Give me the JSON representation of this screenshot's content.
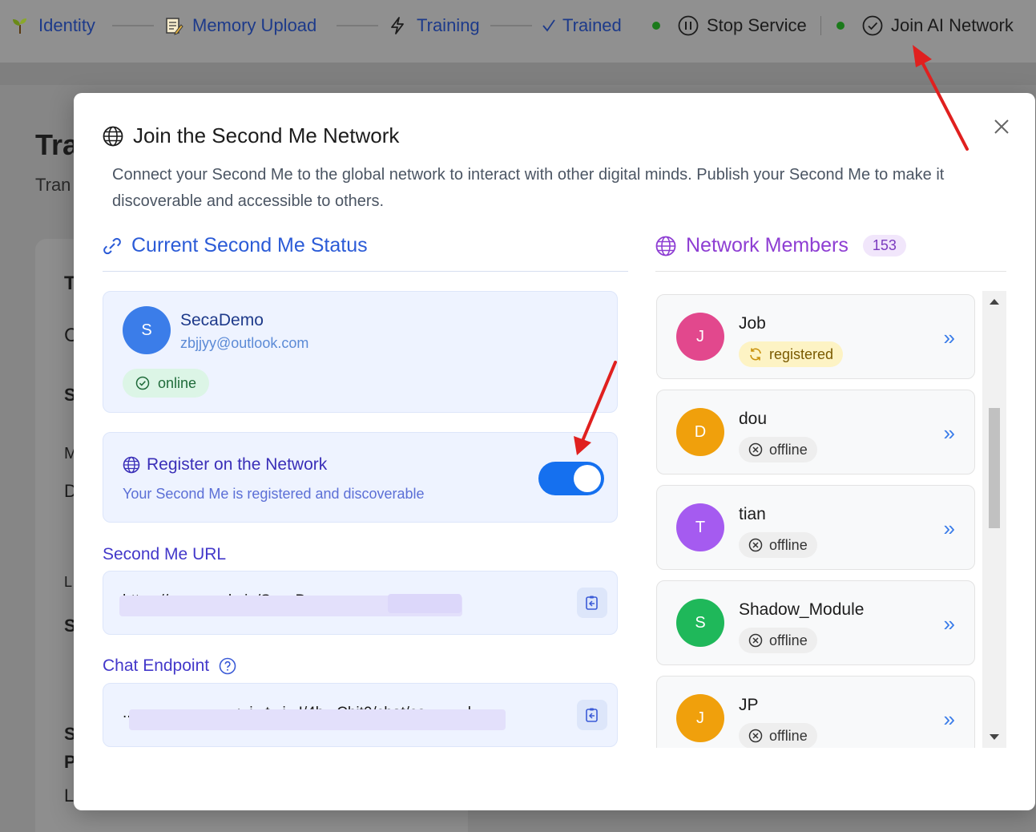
{
  "topnav": {
    "steps": [
      {
        "label": "Identity",
        "icon": "sprout-icon"
      },
      {
        "label": "Memory Upload",
        "icon": "document-edit-icon"
      },
      {
        "label": "Training",
        "icon": "lightning-icon"
      },
      {
        "label": "Trained",
        "icon": "check-icon"
      }
    ],
    "stop_service_label": "Stop Service",
    "join_network_label": "Join AI Network",
    "status_color": "#1b7a1b"
  },
  "background": {
    "title_fragment": "Tra",
    "subtitle_fragment": "Tran",
    "fragments": [
      "T",
      "C",
      "S",
      "M",
      "D",
      "L",
      "S",
      "S",
      "P",
      "L"
    ]
  },
  "modal": {
    "title": "Join the Second Me Network",
    "description": "Connect your Second Me to the global network to interact with other digital minds. Publish your Second Me to make it discoverable and accessible to others.",
    "status_section_title": "Current Second Me Status",
    "profile": {
      "initial": "S",
      "name": "SecaDemo",
      "email": "zbjjyy@outlook.com",
      "status": "online"
    },
    "register": {
      "title": "Register on the Network",
      "subtitle": "Your Second Me is registered and discoverable",
      "enabled": true
    },
    "url_label": "Second Me URL",
    "url_value": "https://...........oda.io/SecaD.............p",
    "chat_label": "Chat Endpoint",
    "chat_value": "...........................:..i...t...i...I/4b...Chit0/chat/co..........l...",
    "members_section_title": "Network Members",
    "members_count": "153",
    "members": [
      {
        "initial": "J",
        "name": "Job",
        "status": "registered",
        "color": "#e2488d"
      },
      {
        "initial": "D",
        "name": "dou",
        "status": "offline",
        "color": "#f0a00c"
      },
      {
        "initial": "T",
        "name": "tian",
        "status": "offline",
        "color": "#a55bf0"
      },
      {
        "initial": "S",
        "name": "Shadow_Module",
        "status": "offline",
        "color": "#1fb85a"
      },
      {
        "initial": "J",
        "name": "JP",
        "status": "offline",
        "color": "#f0a00c"
      }
    ]
  },
  "colors": {
    "accent_blue": "#2b5bd7",
    "accent_purple": "#8e3ed3",
    "toggle_on": "#1570ef",
    "annotation_red": "#e0201f"
  }
}
